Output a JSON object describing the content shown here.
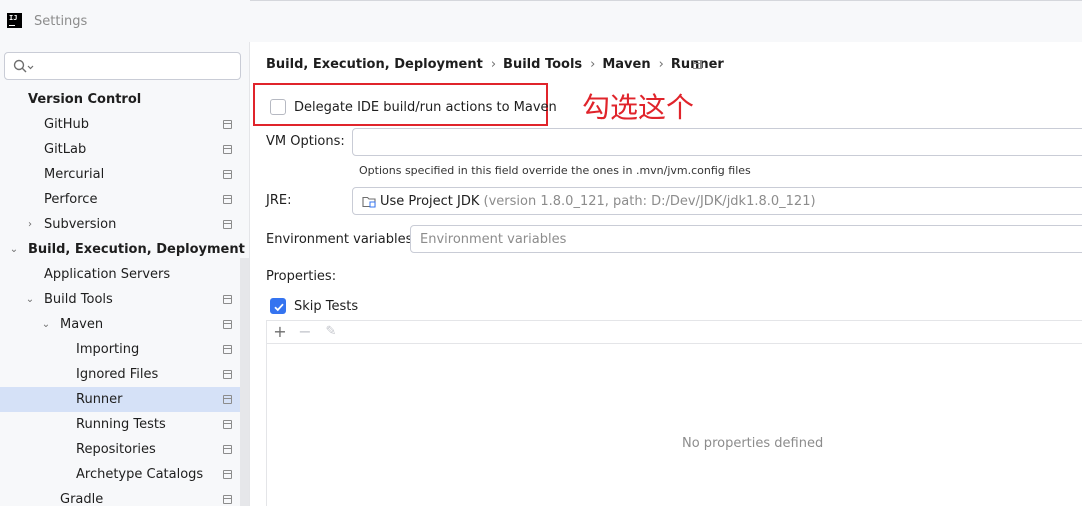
{
  "window": {
    "title": "Settings",
    "logo_text": "IJ"
  },
  "sidebar": {
    "search": {
      "placeholder": ""
    },
    "items": [
      {
        "label": "Version Control",
        "bold": true,
        "level": 0,
        "chevron": "",
        "proj": false,
        "selected": false
      },
      {
        "label": "GitHub",
        "bold": false,
        "level": 1,
        "chevron": "",
        "proj": true,
        "selected": false
      },
      {
        "label": "GitLab",
        "bold": false,
        "level": 1,
        "chevron": "",
        "proj": true,
        "selected": false
      },
      {
        "label": "Mercurial",
        "bold": false,
        "level": 1,
        "chevron": "",
        "proj": true,
        "selected": false
      },
      {
        "label": "Perforce",
        "bold": false,
        "level": 1,
        "chevron": "",
        "proj": true,
        "selected": false
      },
      {
        "label": "Subversion",
        "bold": false,
        "level": 1,
        "chevron": "›",
        "proj": true,
        "selected": false
      },
      {
        "label": "Build, Execution, Deployment",
        "bold": true,
        "level": 0,
        "chevron": "⌄",
        "proj": false,
        "selected": false
      },
      {
        "label": "Application Servers",
        "bold": false,
        "level": 1,
        "chevron": "",
        "proj": false,
        "selected": false
      },
      {
        "label": "Build Tools",
        "bold": false,
        "level": 1,
        "chevron": "⌄",
        "proj": true,
        "selected": false
      },
      {
        "label": "Maven",
        "bold": false,
        "level": 2,
        "chevron": "⌄",
        "proj": true,
        "selected": false
      },
      {
        "label": "Importing",
        "bold": false,
        "level": 3,
        "chevron": "",
        "proj": true,
        "selected": false
      },
      {
        "label": "Ignored Files",
        "bold": false,
        "level": 3,
        "chevron": "",
        "proj": true,
        "selected": false
      },
      {
        "label": "Runner",
        "bold": false,
        "level": 3,
        "chevron": "",
        "proj": true,
        "selected": true
      },
      {
        "label": "Running Tests",
        "bold": false,
        "level": 3,
        "chevron": "",
        "proj": true,
        "selected": false
      },
      {
        "label": "Repositories",
        "bold": false,
        "level": 3,
        "chevron": "",
        "proj": true,
        "selected": false
      },
      {
        "label": "Archetype Catalogs",
        "bold": false,
        "level": 3,
        "chevron": "",
        "proj": true,
        "selected": false
      },
      {
        "label": "Gradle",
        "bold": false,
        "level": 2,
        "chevron": "",
        "proj": true,
        "selected": false
      }
    ]
  },
  "breadcrumb": [
    "Build, Execution, Deployment",
    "Build Tools",
    "Maven",
    "Runner"
  ],
  "breadcrumb_separator": "›",
  "runner": {
    "delegate": {
      "label": "Delegate IDE build/run actions to Maven",
      "checked": false
    },
    "annotation": "勾选这个",
    "vm_options": {
      "label": "VM Options:",
      "value": "",
      "hint": "Options specified in this field override the ones in .mvn/jvm.config files"
    },
    "jre": {
      "label": "JRE:",
      "value": "Use Project JDK",
      "detail": "(version 1.8.0_121, path: D:/Dev/JDK/jdk1.8.0_121)"
    },
    "env": {
      "label": "Environment variables:",
      "placeholder": "Environment variables"
    },
    "properties": {
      "label": "Properties:",
      "skip_tests": {
        "label": "Skip Tests",
        "checked": true
      },
      "toolbar": {
        "add": "+",
        "remove": "−",
        "edit": "✎"
      },
      "empty_text": "No properties defined"
    }
  },
  "colors": {
    "accent": "#3574f0",
    "selection": "#d5e1f7",
    "annotation": "#e0242b"
  }
}
